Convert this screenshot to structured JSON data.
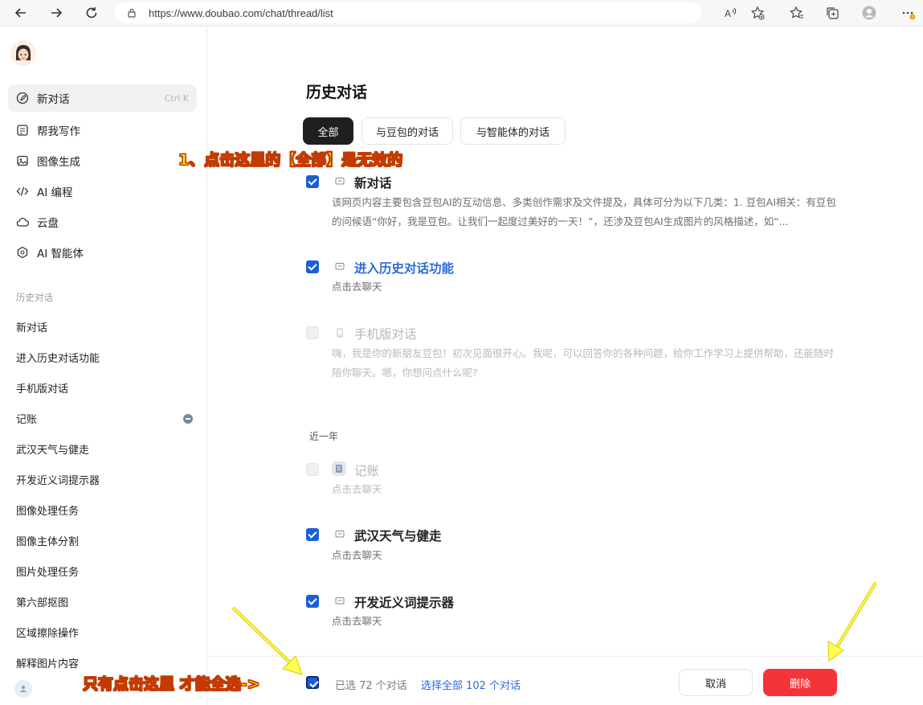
{
  "browser": {
    "url": "https://www.doubao.com/chat/thread/list",
    "icons": [
      "back-icon",
      "forward-icon",
      "refresh-icon",
      "lock-icon",
      "read-aloud-icon",
      "add-favorite-icon",
      "favorites-icon",
      "collections-icon",
      "profile-icon",
      "more-icon"
    ]
  },
  "sidebar": {
    "nav": [
      {
        "label": "新对话",
        "shortcut": "Ctrl K",
        "icon": "edit-icon",
        "active": true
      },
      {
        "label": "帮我写作",
        "icon": "write-icon"
      },
      {
        "label": "图像生成",
        "icon": "image-icon"
      },
      {
        "label": "AI 编程",
        "icon": "code-icon"
      },
      {
        "label": "云盘",
        "icon": "cloud-icon"
      },
      {
        "label": "AI 智能体",
        "icon": "agent-icon"
      }
    ],
    "history_label": "历史对话",
    "history": [
      {
        "label": "新对话"
      },
      {
        "label": "进入历史对话功能"
      },
      {
        "label": "手机版对话"
      },
      {
        "label": "记账"
      },
      {
        "label": "武汉天气与健走"
      },
      {
        "label": "开发近义词提示器"
      },
      {
        "label": "图像处理任务"
      },
      {
        "label": "图像主体分割"
      },
      {
        "label": "图片处理任务"
      },
      {
        "label": "第六部抠图"
      },
      {
        "label": "区域擦除操作"
      },
      {
        "label": "解释图片内容"
      }
    ]
  },
  "main": {
    "title": "历史对话",
    "tabs": [
      {
        "label": "全部",
        "active": true
      },
      {
        "label": "与豆包的对话"
      },
      {
        "label": "与智能体的对话"
      }
    ],
    "items": [
      {
        "title": "新对话",
        "desc": "该网页内容主要包含豆包AI的互动信息、多类创作需求及文件提及，具体可分为以下几类：1. 豆包AI相关：有豆包的问候语“你好，我是豆包。让我们一起度过美好的一天！”，还涉及豆包AI生成图片的风格描述，如“...",
        "checked": true
      },
      {
        "title": "进入历史对话功能",
        "desc": "点击去聊天",
        "checked": true
      },
      {
        "title": "手机版对话",
        "desc": "嗨，我是你的新朋友豆包！初次见面很开心。我呢，可以回答你的各种问题，给你工作学习上提供帮助，还能随时陪你聊天。嗯，你想问点什么呢?",
        "checked": false
      },
      {
        "title": "记账",
        "desc": "点击去聊天",
        "checked": false
      },
      {
        "title": "武汉天气与健走",
        "desc": "点击去聊天",
        "checked": true
      },
      {
        "title": "开发近义词提示器",
        "desc": "点击去聊天",
        "checked": true
      }
    ],
    "group_label": "近一年"
  },
  "bottom": {
    "selected": "已选 72 个对话",
    "select_all": "选择全部 102 个对话",
    "cancel": "取消",
    "delete": "删除"
  },
  "annotations": {
    "top": "1、点击这里的【全部】是无效的",
    "bottom": "只有点击这里 才能全选->"
  },
  "colors": {
    "accent": "#1a5fd8",
    "danger": "#f5343a",
    "annotation_fill": "#ffe600",
    "annotation_stroke": "#c33b00"
  }
}
